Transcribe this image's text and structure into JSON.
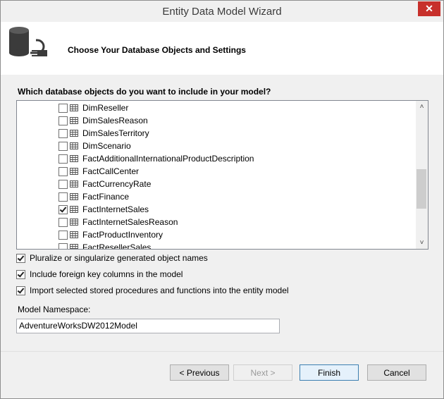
{
  "window": {
    "title": "Entity Data Model Wizard",
    "close_glyph": "✕"
  },
  "header": {
    "title": "Choose Your Database Objects and Settings",
    "icon": "database-plug-icon"
  },
  "question": "Which database objects do you want to include in your model?",
  "objects": [
    {
      "label": "DimReseller",
      "checked": false
    },
    {
      "label": "DimSalesReason",
      "checked": false
    },
    {
      "label": "DimSalesTerritory",
      "checked": false
    },
    {
      "label": "DimScenario",
      "checked": false
    },
    {
      "label": "FactAdditionalInternationalProductDescription",
      "checked": false
    },
    {
      "label": "FactCallCenter",
      "checked": false
    },
    {
      "label": "FactCurrencyRate",
      "checked": false
    },
    {
      "label": "FactFinance",
      "checked": false
    },
    {
      "label": "FactInternetSales",
      "checked": true
    },
    {
      "label": "FactInternetSalesReason",
      "checked": false
    },
    {
      "label": "FactProductInventory",
      "checked": false
    },
    {
      "label": "FactResellerSales",
      "checked": false
    }
  ],
  "scrollbar": {
    "up_glyph": "˄",
    "down_glyph": "˅"
  },
  "options": {
    "pluralize": {
      "label": "Pluralize or singularize generated object names",
      "checked": true
    },
    "foreign_keys": {
      "label": "Include foreign key columns in the model",
      "checked": true
    },
    "import_procs": {
      "label": "Import selected stored procedures and functions into the entity model",
      "checked": true
    }
  },
  "namespace": {
    "label": "Model Namespace:",
    "value": "AdventureWorksDW2012Model"
  },
  "buttons": {
    "previous": "< Previous",
    "next": "Next >",
    "finish": "Finish",
    "cancel": "Cancel"
  },
  "colors": {
    "close_button": "#c7302b",
    "default_button_border": "#3c7fb1"
  }
}
